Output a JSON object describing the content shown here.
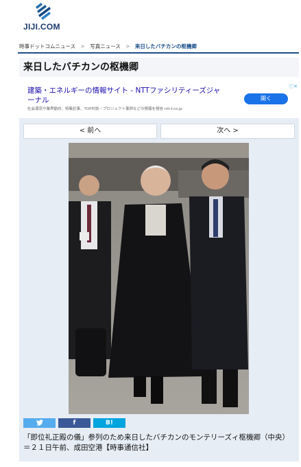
{
  "site": {
    "logo_text": "JIJI.COM"
  },
  "breadcrumb": {
    "items": [
      "時事ドットコムニュース",
      "写真ニュース"
    ],
    "current": "来日したバチカンの枢機卿",
    "separator": ">"
  },
  "page": {
    "title": "来日したバチカンの枢機卿"
  },
  "ad": {
    "title": "建築・エネルギーの情報サイト - NTTファシリティーズジャーナル",
    "description": "社会潮流や業界動向、特集記事、TOP対談・プロジェクト事例などの情報を発信 ntt-f.co.jp",
    "button": "開く"
  },
  "nav": {
    "prev": "< 前へ",
    "next": "次へ >"
  },
  "share": {
    "twitter": "",
    "facebook": "f",
    "hatena": "B!"
  },
  "caption": "「即位礼正殿の儀」参列のため来日したバチカンのモンテリーズィ枢機卿（中央）＝２１日午前、成田空港【時事通信社】"
}
